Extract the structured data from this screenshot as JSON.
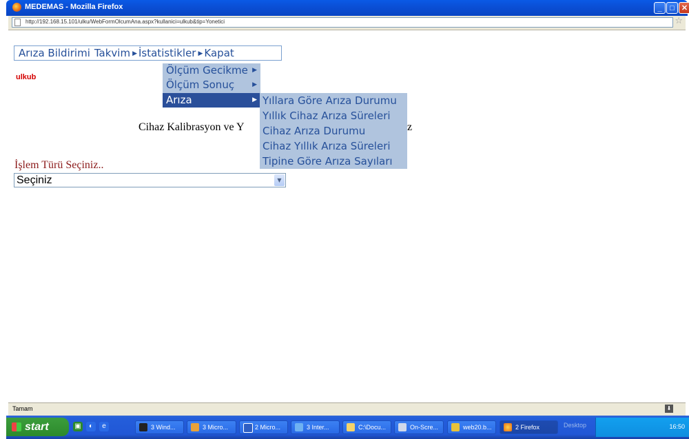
{
  "window": {
    "title": "MEDEMAS - Mozilla Firefox",
    "url": "http://192.168.15.101/ulku/WebFormOlcumAna.aspx?kullanici=ulkub&tip=Yonetici",
    "status": "Tamam"
  },
  "menu": {
    "items": [
      "Arıza Bildirimi",
      "Takvim",
      "İstatistikler",
      "Kapat"
    ],
    "statistics_submenu": [
      "Ölçüm Gecikme",
      "Ölçüm Sonuç",
      "Arıza"
    ],
    "ariza_submenu": [
      "Yıllara Göre Arıza Durumu",
      "Yıllık Cihaz Arıza Süreleri",
      "Cihaz Arıza Durumu",
      "Cihaz Yıllık Arıza Süreleri",
      "Tipine Göre Arıza Sayıları"
    ]
  },
  "page": {
    "username": "ulkub",
    "heading_start": "Cihaz Kalibrasyon ve Y",
    "heading_end": "z",
    "islem_label": "İşlem Türü Seçiniz..",
    "select_value": "Seçiniz"
  },
  "taskbar": {
    "start": "start",
    "buttons": [
      "3 Wind...",
      "3 Micro...",
      "2 Micro...",
      "3 Inter...",
      "C:\\Docu...",
      "On-Scre...",
      "web20.b...",
      "2 Firefox"
    ],
    "desktop": "Desktop",
    "clock": "16:50"
  }
}
